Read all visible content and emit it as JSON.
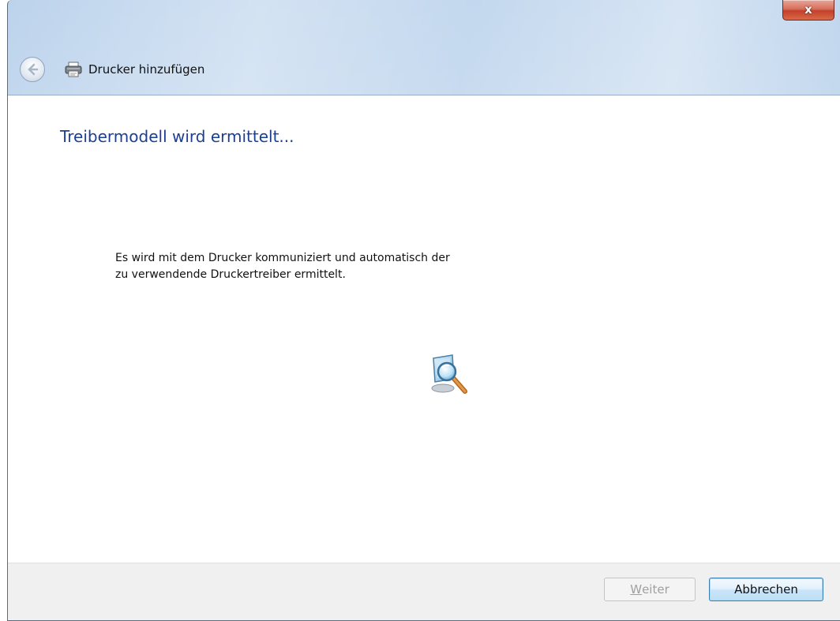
{
  "window": {
    "title": "Drucker hinzufügen",
    "close_label": "x"
  },
  "icons": {
    "back": "back-arrow-icon",
    "printer": "printer-icon",
    "search": "computer-magnifier-icon"
  },
  "content": {
    "heading": "Treibermodell wird ermittelt...",
    "description_line1": "Es wird mit dem Drucker kommuniziert und automatisch der",
    "description_line2": "zu verwendende Druckertreiber ermittelt."
  },
  "footer": {
    "next_label_mnemonic": "W",
    "next_label_rest": "eiter",
    "next_enabled": false,
    "cancel_label": "Abbrechen"
  },
  "colors": {
    "heading": "#1c3f94",
    "close_button": "#c3402a",
    "footer_bg": "#f0f0f0",
    "default_button_border": "#3c7fb1"
  }
}
